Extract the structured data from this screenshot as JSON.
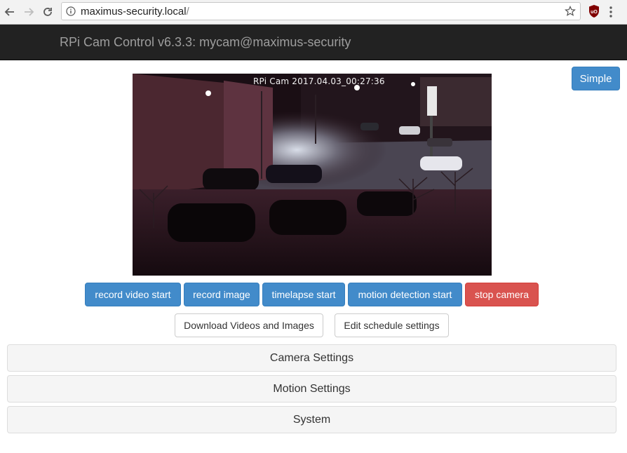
{
  "browser": {
    "url_host": "maximus-security.local",
    "url_path": "/",
    "ext_label": "uO"
  },
  "navbar": {
    "brand": "RPi Cam Control v6.3.3: mycam@maximus-security"
  },
  "simple_button": "Simple",
  "preview": {
    "timestamp": "RPi Cam  2017.04.03_00:27:36"
  },
  "actions": {
    "record_video": "record video start",
    "record_image": "record image",
    "timelapse": "timelapse start",
    "motion_detection": "motion detection start",
    "stop_camera": "stop camera"
  },
  "links": {
    "download": "Download Videos and Images",
    "schedule": "Edit schedule settings"
  },
  "panels": {
    "camera": "Camera Settings",
    "motion": "Motion Settings",
    "system": "System"
  },
  "colors": {
    "primary": "#428bca",
    "danger": "#d9534f",
    "navbar": "#222222"
  }
}
